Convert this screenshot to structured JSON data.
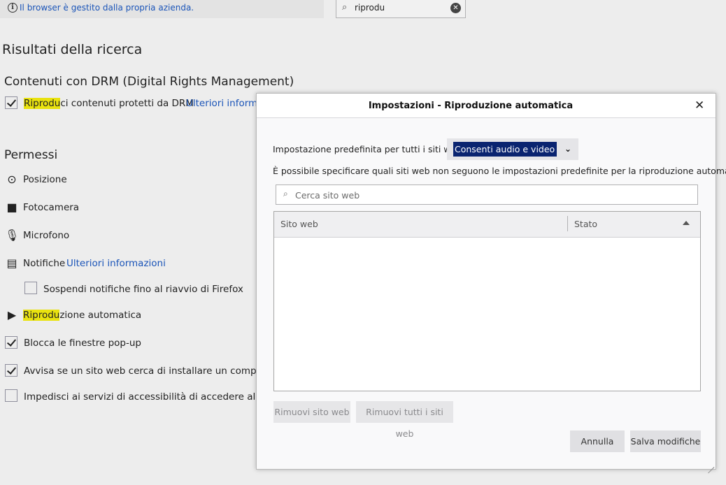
{
  "topbar": {
    "managed_notice": "Il browser è gestito dalla propria azienda.",
    "search_value": "riprodu"
  },
  "prefs": {
    "results_title": "Risultati della ricerca",
    "drm": {
      "heading": "Contenuti con DRM (Digital Rights Management)",
      "play_highlight": "Riprodu",
      "play_rest": "ci contenuti protetti da DRM",
      "learn_more": "Ulteriori informaz"
    },
    "permissions": {
      "heading": "Permessi",
      "location": "Posizione",
      "camera": "Fotocamera",
      "microphone": "Microfono",
      "notifications": "Notifiche",
      "notifications_learn_more": "Ulteriori informazioni",
      "pause_notifications": "Sospendi notifiche fino al riavvio di Firefox",
      "autoplay_highlight": "Riprodu",
      "autoplay_rest": "zione automatica",
      "block_popups": "Blocca le finestre pop-up",
      "warn_addons": "Avvisa se un sito web cerca di installare un component",
      "block_accessibility": "Impedisci ai servizi di accessibilità di accedere al browser"
    }
  },
  "dialog": {
    "title": "Impostazioni - Riproduzione automatica",
    "default_label": "Impostazione predefinita per tutti i siti web:",
    "default_value": "Consenti audio e video",
    "description": "È possibile specificare quali siti web non seguono le impostazioni predefinite per la riproduzione automatica.",
    "search_placeholder": "Cerca sito web",
    "columns": {
      "site": "Sito web",
      "status": "Stato"
    },
    "remove_site": "Rimuovi sito web",
    "remove_all": "Rimuovi tutti i siti web",
    "cancel": "Annulla",
    "save": "Salva modifiche"
  }
}
